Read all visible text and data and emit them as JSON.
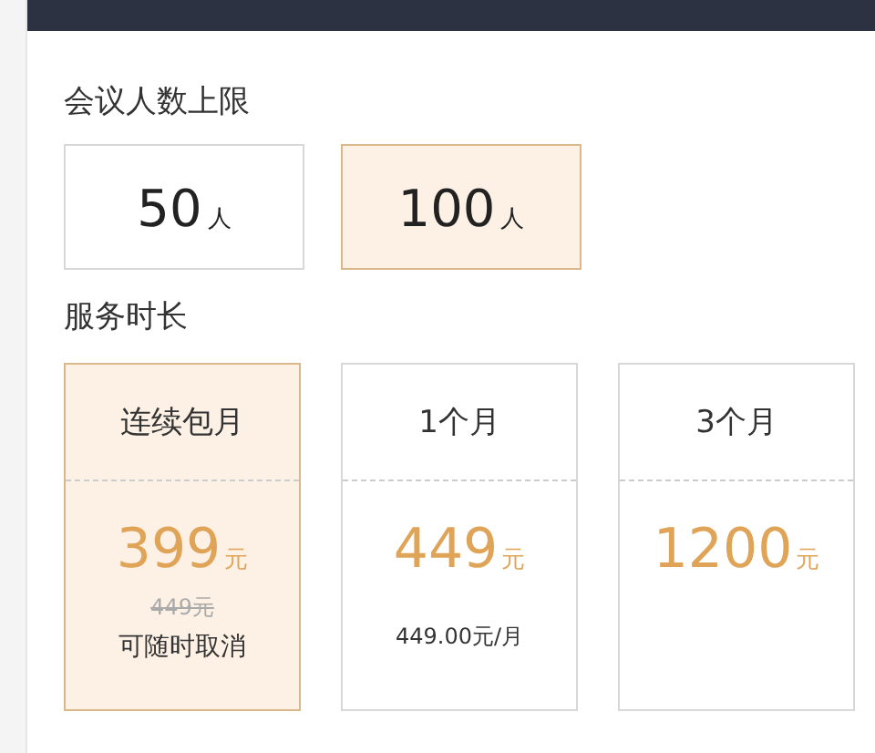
{
  "limit_section": {
    "title": "会议人数上限",
    "options": [
      {
        "number": "50",
        "unit": "人",
        "selected": false
      },
      {
        "number": "100",
        "unit": "人",
        "selected": true
      }
    ]
  },
  "duration_section": {
    "title": "服务时长",
    "plans": [
      {
        "name": "连续包月",
        "price": "399",
        "currency": "元",
        "original_price": "449元",
        "note": "可随时取消",
        "selected": true
      },
      {
        "name": "1个月",
        "price": "449",
        "currency": "元",
        "note": "449.00元/月",
        "selected": false
      },
      {
        "name": "3个月",
        "price": "1200",
        "currency": "元",
        "selected": false
      }
    ]
  }
}
